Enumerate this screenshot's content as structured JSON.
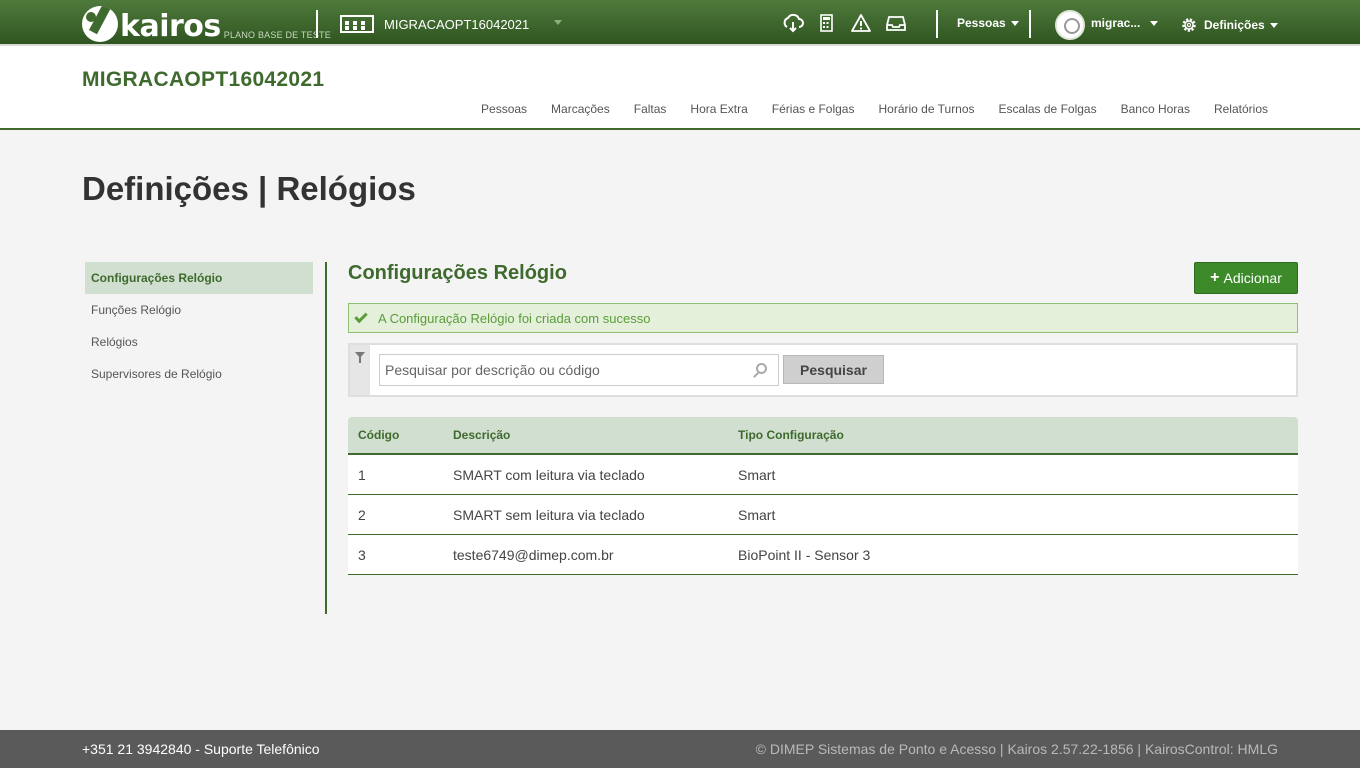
{
  "topbar": {
    "logo_text": "kairos",
    "logo_subtitle": "PLANO BASE DE TESTE",
    "company_name": "MIGRACAOPT16042021",
    "icons": [
      "cloud-download-icon",
      "calculator-icon",
      "warning-icon",
      "inbox-icon"
    ],
    "people_menu": "Pessoas",
    "user_name": "migrac...",
    "settings_menu": "Definições"
  },
  "header": {
    "company_title": "MIGRACAOPT16042021",
    "nav": [
      "Pessoas",
      "Marcações",
      "Faltas",
      "Hora Extra",
      "Férias e Folgas",
      "Horário de Turnos",
      "Escalas de Folgas",
      "Banco Horas",
      "Relatórios"
    ]
  },
  "page_title": "Definições | Relógios",
  "sidebar": {
    "items": [
      {
        "label": "Configurações Relógio",
        "active": true
      },
      {
        "label": "Funções Relógio",
        "active": false
      },
      {
        "label": "Relógios",
        "active": false
      },
      {
        "label": "Supervisores de Relógio",
        "active": false
      }
    ]
  },
  "main": {
    "section_title": "Configurações Relógio",
    "add_button": "Adicionar",
    "alert_text": "A Configuração Relógio foi criada com sucesso",
    "search": {
      "placeholder": "Pesquisar por descrição ou código",
      "value": "",
      "button": "Pesquisar"
    },
    "table": {
      "headers": [
        "Código",
        "Descrição",
        "Tipo Configuração"
      ],
      "rows": [
        [
          "1",
          "SMART com leitura via teclado",
          "Smart"
        ],
        [
          "2",
          "SMART sem leitura via teclado",
          "Smart"
        ],
        [
          "3",
          "teste6749@dimep.com.br",
          "BioPoint II - Sensor 3"
        ]
      ]
    }
  },
  "footer": {
    "left": "+351 21 3942840 - Suporte Telefônico",
    "right": "© DIMEP Sistemas de Ponto e Acesso | Kairos 2.57.22-1856 | KairosControl: HMLG"
  },
  "colors": {
    "brand_green": "#3f6a2e",
    "topbar_green": "#2f5520",
    "add_button": "#3d8a2a",
    "alert_bg": "#e4f0da",
    "footer_bg": "#5a5a5a"
  }
}
